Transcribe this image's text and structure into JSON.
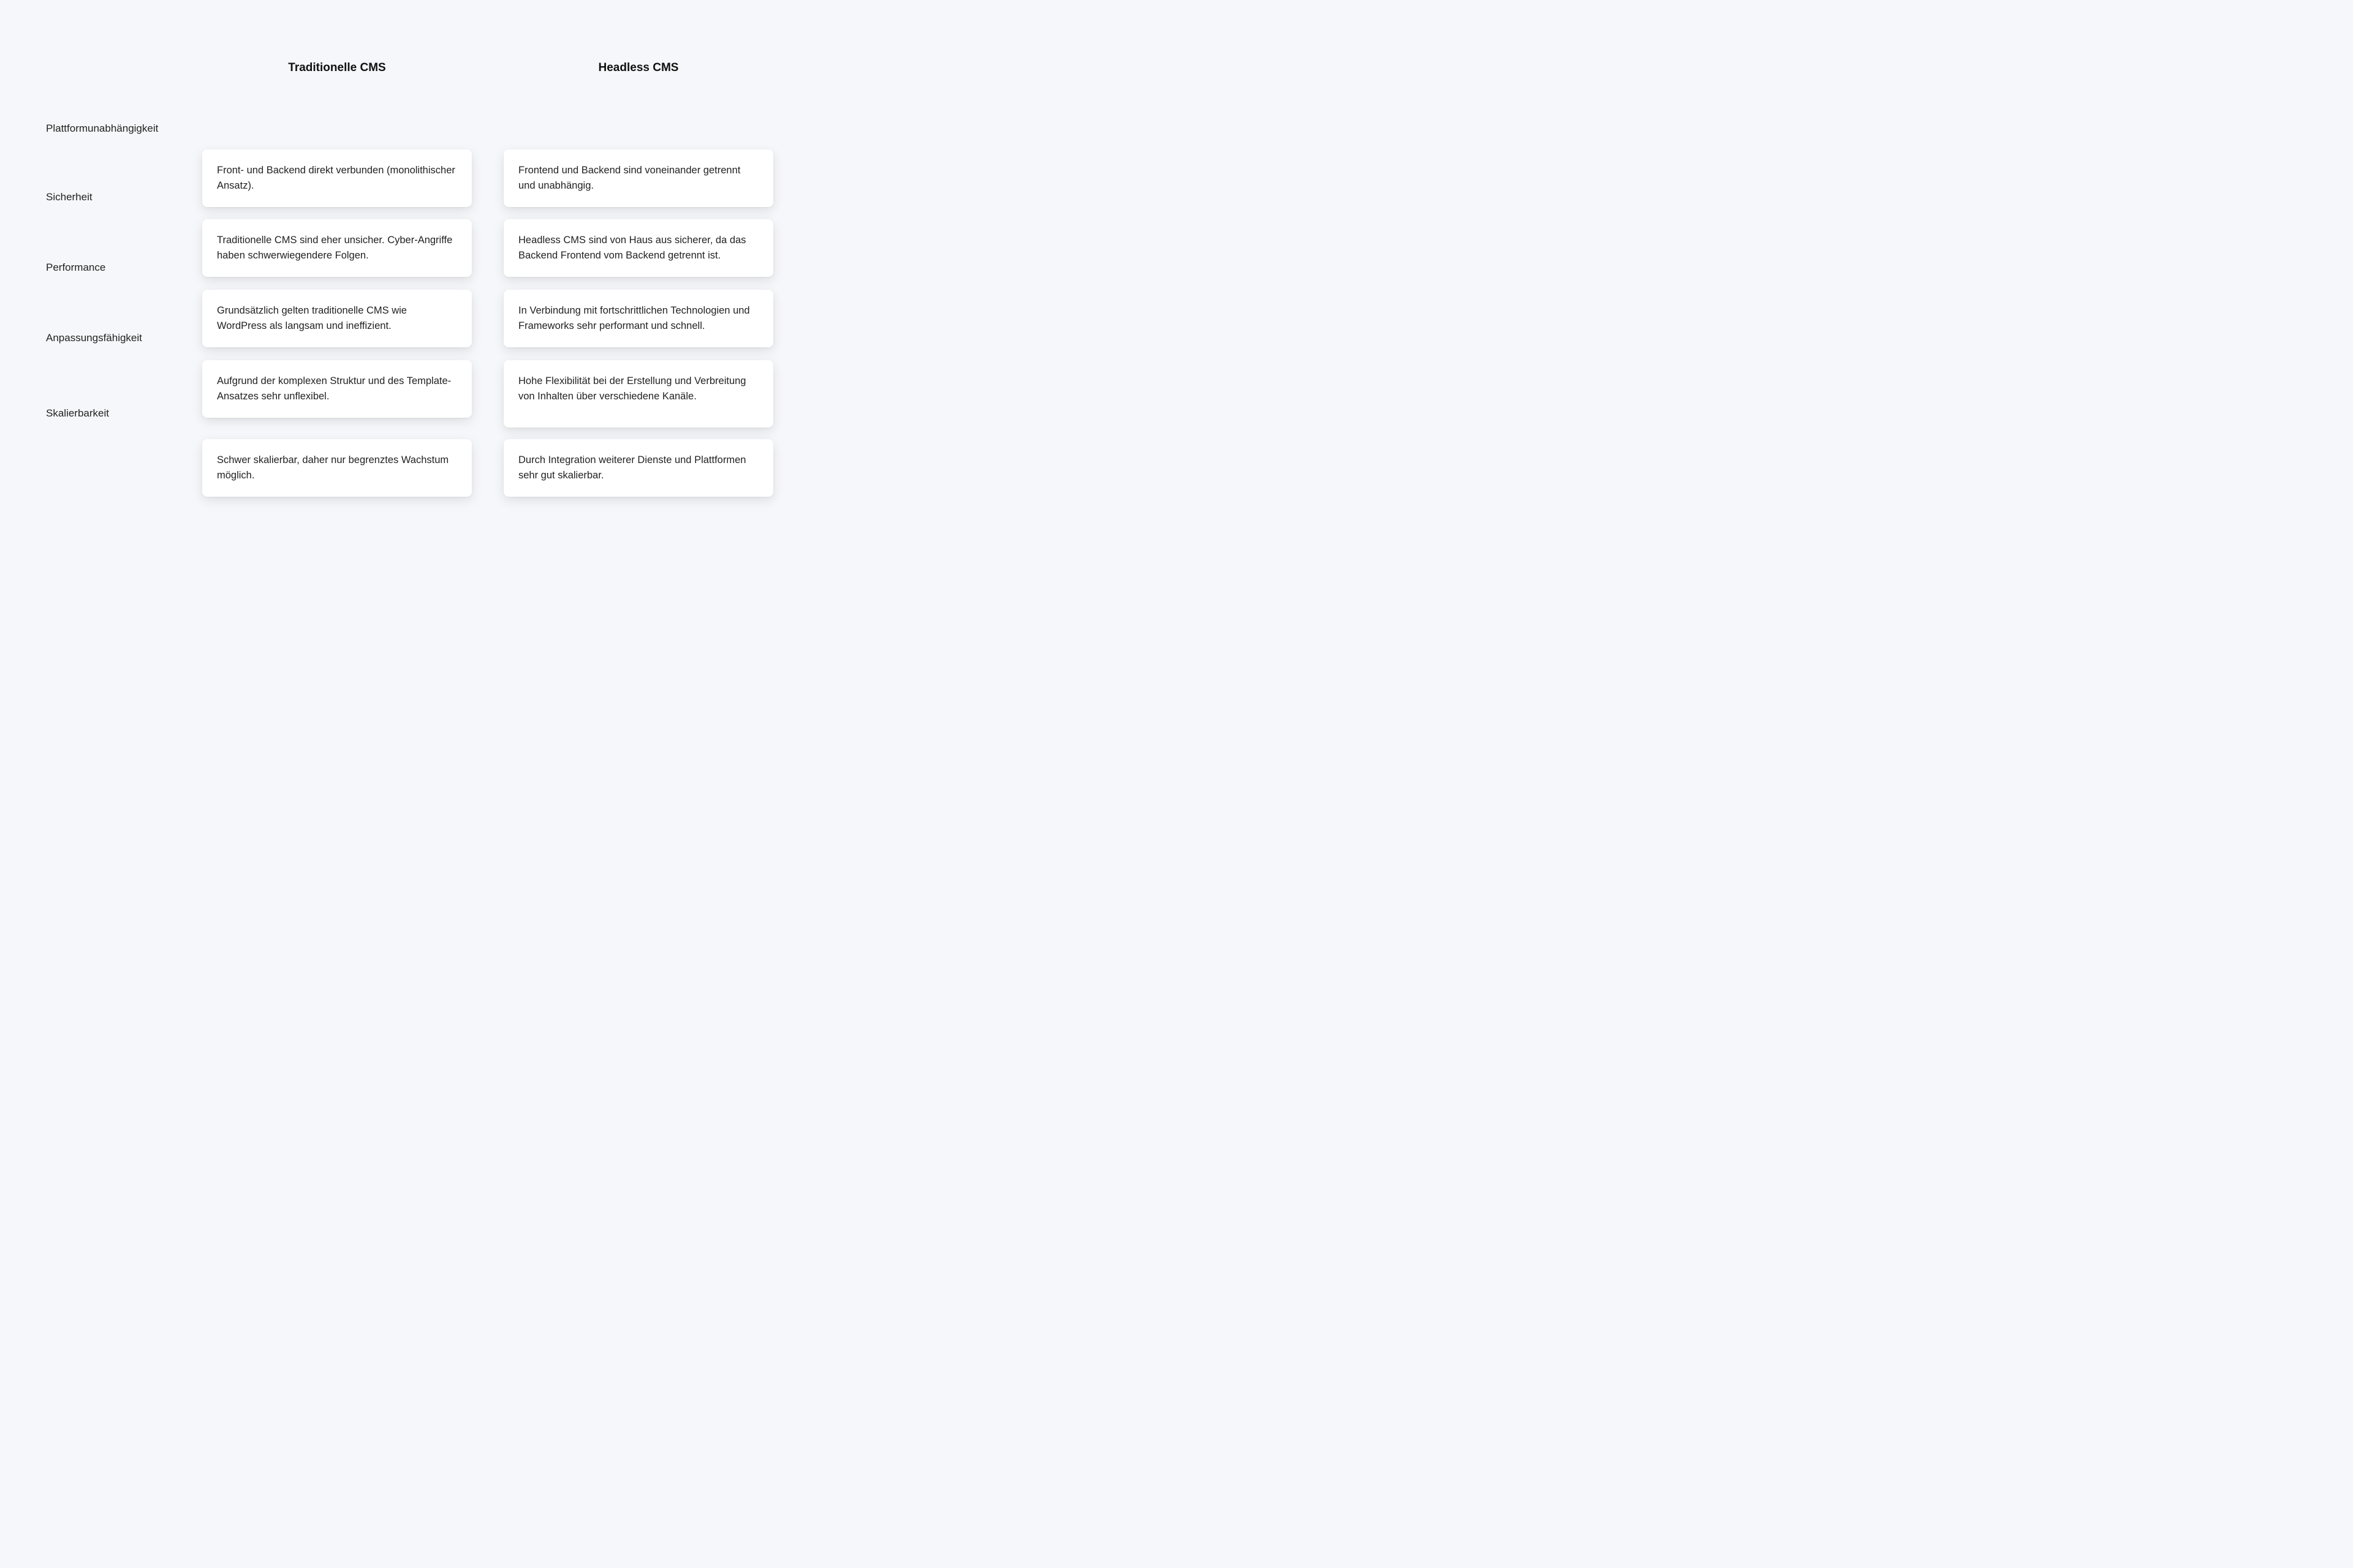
{
  "columns": {
    "traditional": "Traditionelle CMS",
    "headless": "Headless CMS"
  },
  "rows": {
    "platform": "Plattformunabhängigkeit",
    "security": "Sicherheit",
    "performance": "Performance",
    "adaptability": "Anpassungsfähigkeit",
    "scalability": "Skalierbarkeit"
  },
  "cards": {
    "trad_platform": "Front- und Backend direkt verbunden (monolithischer Ansatz).",
    "head_platform": "Frontend und Backend sind voneinander getrennt und unabhängig.",
    "trad_security": "Traditionelle CMS sind eher unsicher. Cyber-Angriffe haben schwerwiegendere Folgen.",
    "head_security": "Headless CMS sind von Haus aus sicherer, da das Backend Frontend vom Backend getrennt ist.",
    "trad_performance": "Grundsätzlich gelten traditionelle CMS wie WordPress als langsam und ineffizient.",
    "head_performance": "In Verbindung mit fortschrittlichen Technologien und Frameworks sehr performant und schnell.",
    "trad_adapt": "Aufgrund der komplexen Struktur und des Template-Ansatzes sehr unflexibel.",
    "head_adapt": "Hohe Flexibilität bei der Erstellung und Verbreitung von Inhalten über verschiedene Kanäle.",
    "trad_scale": "Schwer skalierbar, daher nur begrenztes Wachstum möglich.",
    "head_scale": "Durch Integration weiterer Dienste und Plattformen sehr gut skalierbar."
  }
}
